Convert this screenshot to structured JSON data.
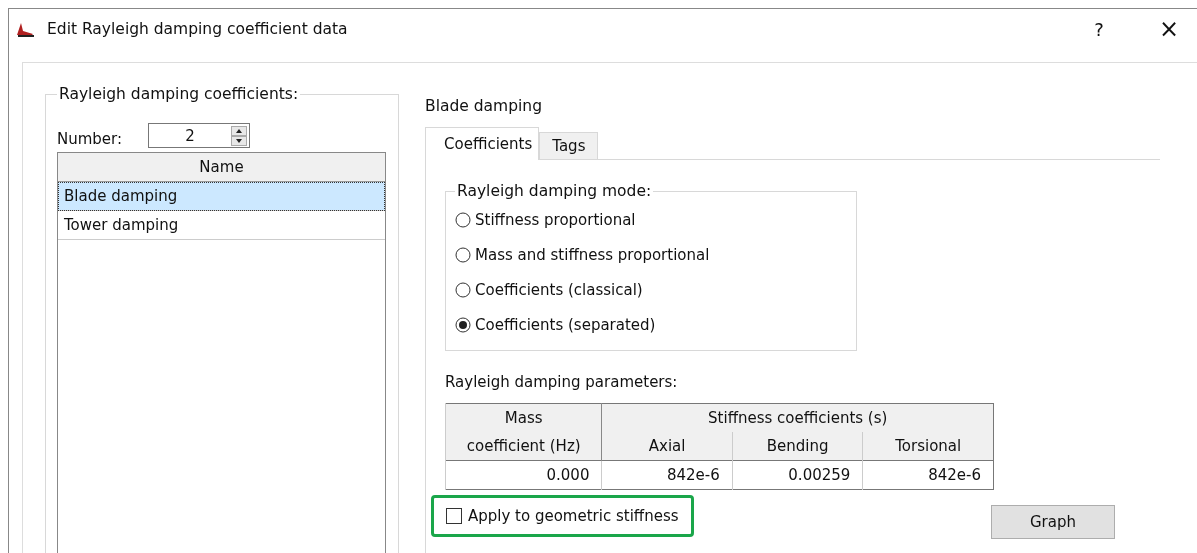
{
  "window": {
    "title": "Edit Rayleigh damping coefficient data",
    "help": "?",
    "close": "×"
  },
  "coefficients_group": {
    "title": "Rayleigh damping coefficients:",
    "number_label": "Number:",
    "number_value": "2",
    "list_header": "Name",
    "items": [
      {
        "name": "Blade damping",
        "selected": true
      },
      {
        "name": "Tower damping",
        "selected": false
      }
    ]
  },
  "detail": {
    "title": "Blade damping",
    "tabs": [
      {
        "label": "Coefficients",
        "selected": true
      },
      {
        "label": "Tags",
        "selected": false
      }
    ],
    "mode_group": {
      "title": "Rayleigh damping mode:",
      "options": [
        {
          "label": "Stiffness proportional",
          "selected": false
        },
        {
          "label": "Mass and stiffness proportional",
          "selected": false
        },
        {
          "label": "Coefficients (classical)",
          "selected": false
        },
        {
          "label": "Coefficients (separated)",
          "selected": true
        }
      ]
    },
    "parameters": {
      "label": "Rayleigh damping parameters:",
      "mass_header": [
        "Mass",
        "coefficient (Hz)"
      ],
      "stiffness_header": "Stiffness coefficients (s)",
      "stiffness_columns": [
        "Axial",
        "Bending",
        "Torsional"
      ],
      "row": [
        "0.000",
        "842e-6",
        "0.00259",
        "842e-6"
      ]
    },
    "checkbox": {
      "label": "Apply to geometric stiffness",
      "checked": false,
      "highlighted": true
    },
    "graph_button": "Graph"
  }
}
